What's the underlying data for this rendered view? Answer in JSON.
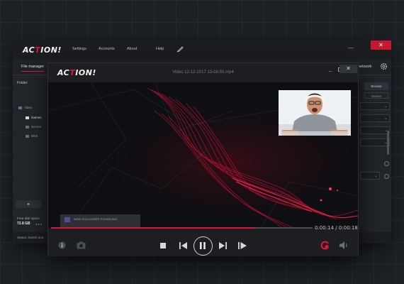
{
  "main_window": {
    "logo": {
      "text_pre": "AC",
      "text_accent": "T",
      "text_post": "ION!"
    },
    "menu": [
      "Settings",
      "Accounts",
      "About",
      "Help"
    ],
    "tabs": {
      "file_manager": "File manager",
      "network": "network"
    },
    "folder_label": "Folder:",
    "tree": [
      {
        "label": "Video",
        "icon": "folder-icon"
      },
      {
        "label": "Games",
        "icon": "gamepad-icon"
      },
      {
        "label": "Screen",
        "icon": "screen-icon"
      },
      {
        "label": "Web",
        "icon": "web-icon"
      }
    ],
    "add_folder": "+",
    "free_space_label": "Free disk space",
    "free_space_value": "72.8 GB",
    "right_panel": {
      "browse": "Browse",
      "device": "Device"
    },
    "status_label": "Status:",
    "status_text": "Switch and..."
  },
  "player": {
    "logo": {
      "text_pre": "AC",
      "text_accent": "T",
      "text_post": "ION!"
    },
    "title": "Video 12-12-2017 13-08-55.mp4",
    "follower_banner": "NEW FOLLOWER FOUNDING",
    "time_current": "0:00:14",
    "time_total": "0:00:18",
    "progress": 0.78,
    "accent_color": "#e2163a"
  }
}
